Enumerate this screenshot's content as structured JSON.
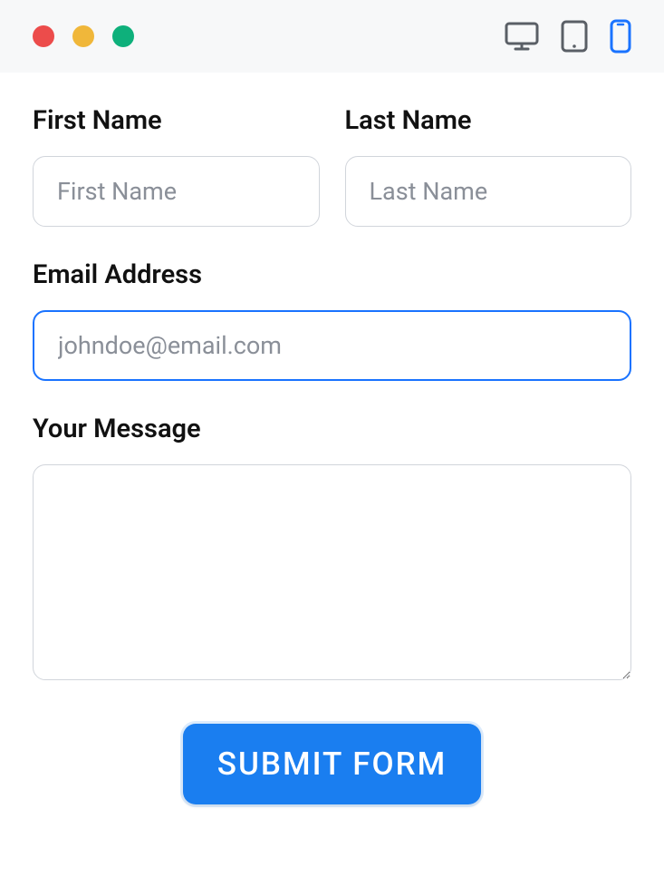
{
  "titlebar": {
    "traffic_lights": [
      "red",
      "yellow",
      "green"
    ],
    "devices": {
      "desktop_icon": "desktop-icon",
      "tablet_icon": "tablet-icon",
      "phone_icon": "phone-icon",
      "active": "phone"
    }
  },
  "form": {
    "first_name": {
      "label": "First Name",
      "placeholder": "First Name",
      "value": ""
    },
    "last_name": {
      "label": "Last Name",
      "placeholder": "Last Name",
      "value": ""
    },
    "email": {
      "label": "Email Address",
      "placeholder": "johndoe@email.com",
      "value": "",
      "focused": true
    },
    "message": {
      "label": "Your Message",
      "placeholder": "",
      "value": ""
    },
    "submit_label": "SUBMIT FORM"
  },
  "colors": {
    "accent": "#1a7ef0",
    "focus_border": "#1a73ff",
    "border": "#d1d5db",
    "placeholder": "#8a8f98",
    "red": "#ec4c4b",
    "yellow": "#f0b73a",
    "green": "#0eb07b"
  }
}
